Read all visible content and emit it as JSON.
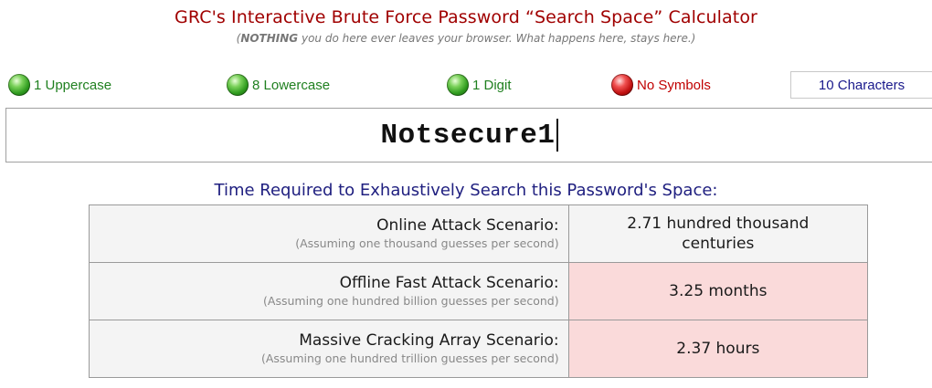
{
  "header": {
    "title": "GRC's Interactive Brute Force Password “Search Space” Calculator",
    "subtitle_bold": "NOTHING",
    "subtitle_rest": " you do here ever leaves your browser. What happens here, stays here.)",
    "subtitle_open": "("
  },
  "indicators": [
    {
      "label": "1 Uppercase",
      "status": "green"
    },
    {
      "label": "8 Lowercase",
      "status": "green"
    },
    {
      "label": "1 Digit",
      "status": "green"
    },
    {
      "label": "No Symbols",
      "status": "red"
    }
  ],
  "char_count": "10 Characters",
  "password": "Notsecure1",
  "time_heading": "Time Required to Exhaustively Search this Password's Space:",
  "scenarios": [
    {
      "name": "Online Attack Scenario:",
      "assumption": "(Assuming one thousand guesses per second)",
      "result_line1": "2.71 hundred thousand",
      "result_line2": "centuries",
      "highlight": false
    },
    {
      "name": "Offline Fast Attack Scenario:",
      "assumption": "(Assuming one hundred billion guesses per second)",
      "result_line1": "3.25 months",
      "result_line2": "",
      "highlight": true
    },
    {
      "name": "Massive Cracking Array Scenario:",
      "assumption": "(Assuming one hundred trillion guesses per second)",
      "result_line1": "2.37 hours",
      "result_line2": "",
      "highlight": true
    }
  ],
  "colors": {
    "title": "#a00000",
    "heading": "#202080",
    "ok": "#208020",
    "bad": "#c00000",
    "highlight": "#fadada"
  }
}
